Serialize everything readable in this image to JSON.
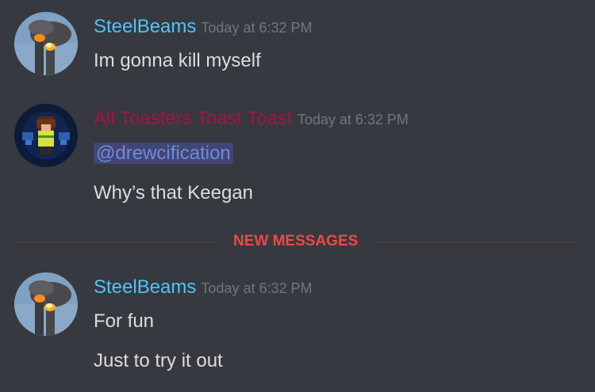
{
  "colors": {
    "background": "#36393f",
    "steelbeams_name": "#4fc3f7",
    "toasters_name": "#a5143e",
    "timestamp": "#72767d",
    "message_text": "#dcddde",
    "mention_text": "#7289da",
    "mention_bg": "#414675",
    "new_messages": "#f04747"
  },
  "messages": [
    {
      "author": "SteelBeams",
      "avatar_icon": "burning-towers-avatar",
      "timestamp": "Today at 6:32 PM",
      "lines": [
        "Im gonna kill myself"
      ]
    },
    {
      "author": "All Toasters Toast Toast",
      "avatar_icon": "pixel-character-avatar",
      "timestamp": "Today at 6:32 PM",
      "mention": "@drewcification",
      "lines": [
        "Why’s that Keegan"
      ]
    },
    {
      "author": "SteelBeams",
      "avatar_icon": "burning-towers-avatar",
      "timestamp": "Today at 6:32 PM",
      "lines": [
        "For fun",
        "Just to try it out"
      ]
    }
  ],
  "divider": {
    "label": "NEW MESSAGES"
  }
}
